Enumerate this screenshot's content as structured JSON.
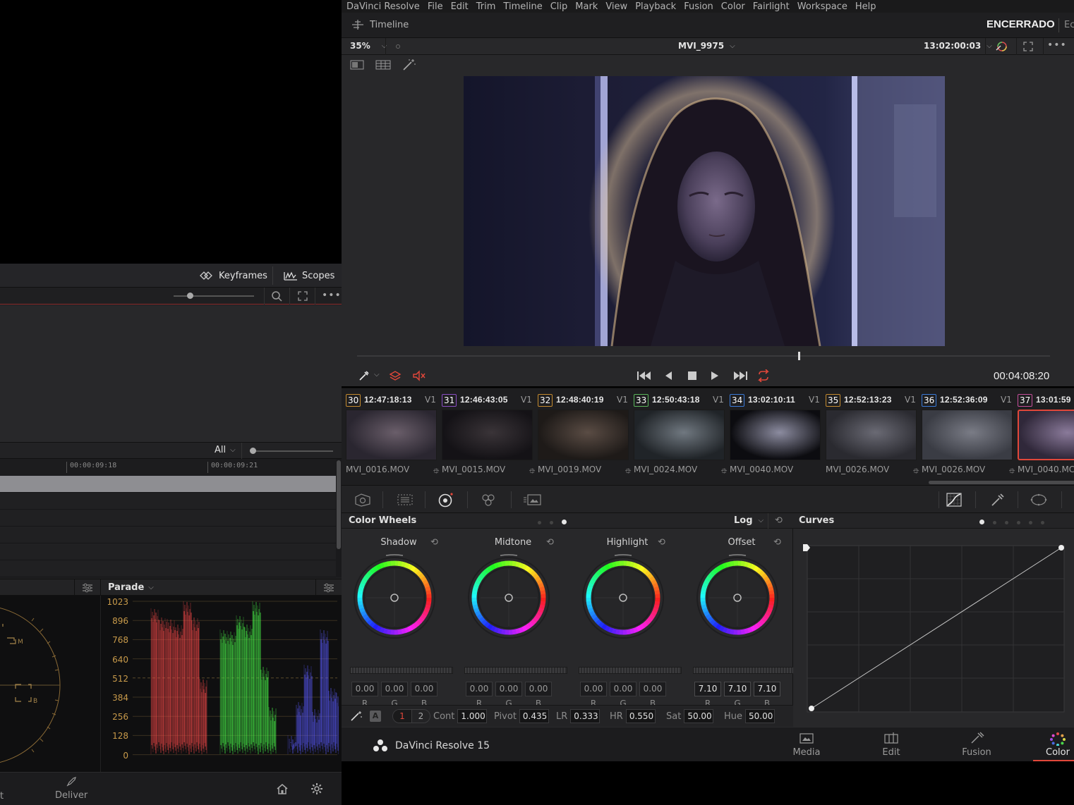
{
  "left_panel": {
    "keyframes_label": "Keyframes",
    "scopes_label": "Scopes",
    "filter_value": "All",
    "ruler": [
      "00:00:09:18",
      "00:00:09:21"
    ],
    "scope_mode": "Parade",
    "parade_scale": [
      "1023",
      "896",
      "768",
      "640",
      "512",
      "384",
      "256",
      "128",
      "0"
    ],
    "vectorscope_labels": {
      "m": "M",
      "b": "B"
    },
    "footer": {
      "left_partial": "t",
      "deliver_label": "Deliver"
    }
  },
  "menu": [
    "DaVinci Resolve",
    "File",
    "Edit",
    "Trim",
    "Timeline",
    "Clip",
    "Mark",
    "View",
    "Playback",
    "Fusion",
    "Color",
    "Fairlight",
    "Workspace",
    "Help"
  ],
  "timeline_bar": {
    "label": "Timeline",
    "project": "ENCERRADO",
    "partial": "Ec"
  },
  "viewer": {
    "zoom": "35%",
    "clip_name": "MVI_9975",
    "timecode": "13:02:00:03",
    "transport_timecode": "00:04:08:20",
    "playhead_fraction": 0.636
  },
  "clips": [
    {
      "num": "30",
      "tc": "12:47:18:13",
      "track": "V1",
      "name": "MVI_0016.MOV",
      "linked": false
    },
    {
      "num": "31",
      "tc": "12:46:43:05",
      "track": "V1",
      "name": "MVI_0015.MOV",
      "linked": true
    },
    {
      "num": "32",
      "tc": "12:48:40:19",
      "track": "V1",
      "name": "MVI_0019.MOV",
      "linked": true
    },
    {
      "num": "33",
      "tc": "12:50:43:18",
      "track": "V1",
      "name": "MVI_0024.MOV",
      "linked": true
    },
    {
      "num": "34",
      "tc": "13:02:10:11",
      "track": "V1",
      "name": "MVI_0040.MOV",
      "linked": true
    },
    {
      "num": "35",
      "tc": "12:52:13:23",
      "track": "V1",
      "name": "MVI_0026.MOV",
      "linked": false
    },
    {
      "num": "36",
      "tc": "12:52:36:09",
      "track": "V1",
      "name": "MVI_0026.MOV",
      "linked": true
    },
    {
      "num": "37",
      "tc": "13:01:59",
      "track": "",
      "name": "MVI_0040.MC",
      "linked": true
    }
  ],
  "color_wheels": {
    "title": "Color Wheels",
    "mode": "Log",
    "wheels": [
      {
        "name": "Shadow",
        "r": "0.00",
        "g": "0.00",
        "b": "0.00"
      },
      {
        "name": "Midtone",
        "r": "0.00",
        "g": "0.00",
        "b": "0.00"
      },
      {
        "name": "Highlight",
        "r": "0.00",
        "g": "0.00",
        "b": "0.00"
      },
      {
        "name": "Offset",
        "r": "7.10",
        "g": "7.10",
        "b": "7.10"
      }
    ],
    "channel_labels": [
      "R",
      "G",
      "B"
    ]
  },
  "primaries": {
    "auto_label": "A",
    "page1": "1",
    "page2": "2",
    "cont_label": "Cont",
    "cont": "1.000",
    "pivot_label": "Pivot",
    "pivot": "0.435",
    "lr_label": "LR",
    "lr": "0.333",
    "hr_label": "HR",
    "hr": "0.550",
    "sat_label": "Sat",
    "sat": "50.00",
    "hue_label": "Hue",
    "hue": "50.00"
  },
  "curves": {
    "title": "Curves"
  },
  "bottom_bar": {
    "app_name": "DaVinci Resolve 15",
    "pages": [
      {
        "label": "Media",
        "icon": "media-icon"
      },
      {
        "label": "Edit",
        "icon": "edit-icon"
      },
      {
        "label": "Fusion",
        "icon": "fusion-icon"
      },
      {
        "label": "Color",
        "icon": "color-icon",
        "active": true
      }
    ]
  },
  "colors": {
    "accent_red": "#e2473a",
    "clip_border_active": "#e2473a",
    "panel": "#28282a"
  }
}
